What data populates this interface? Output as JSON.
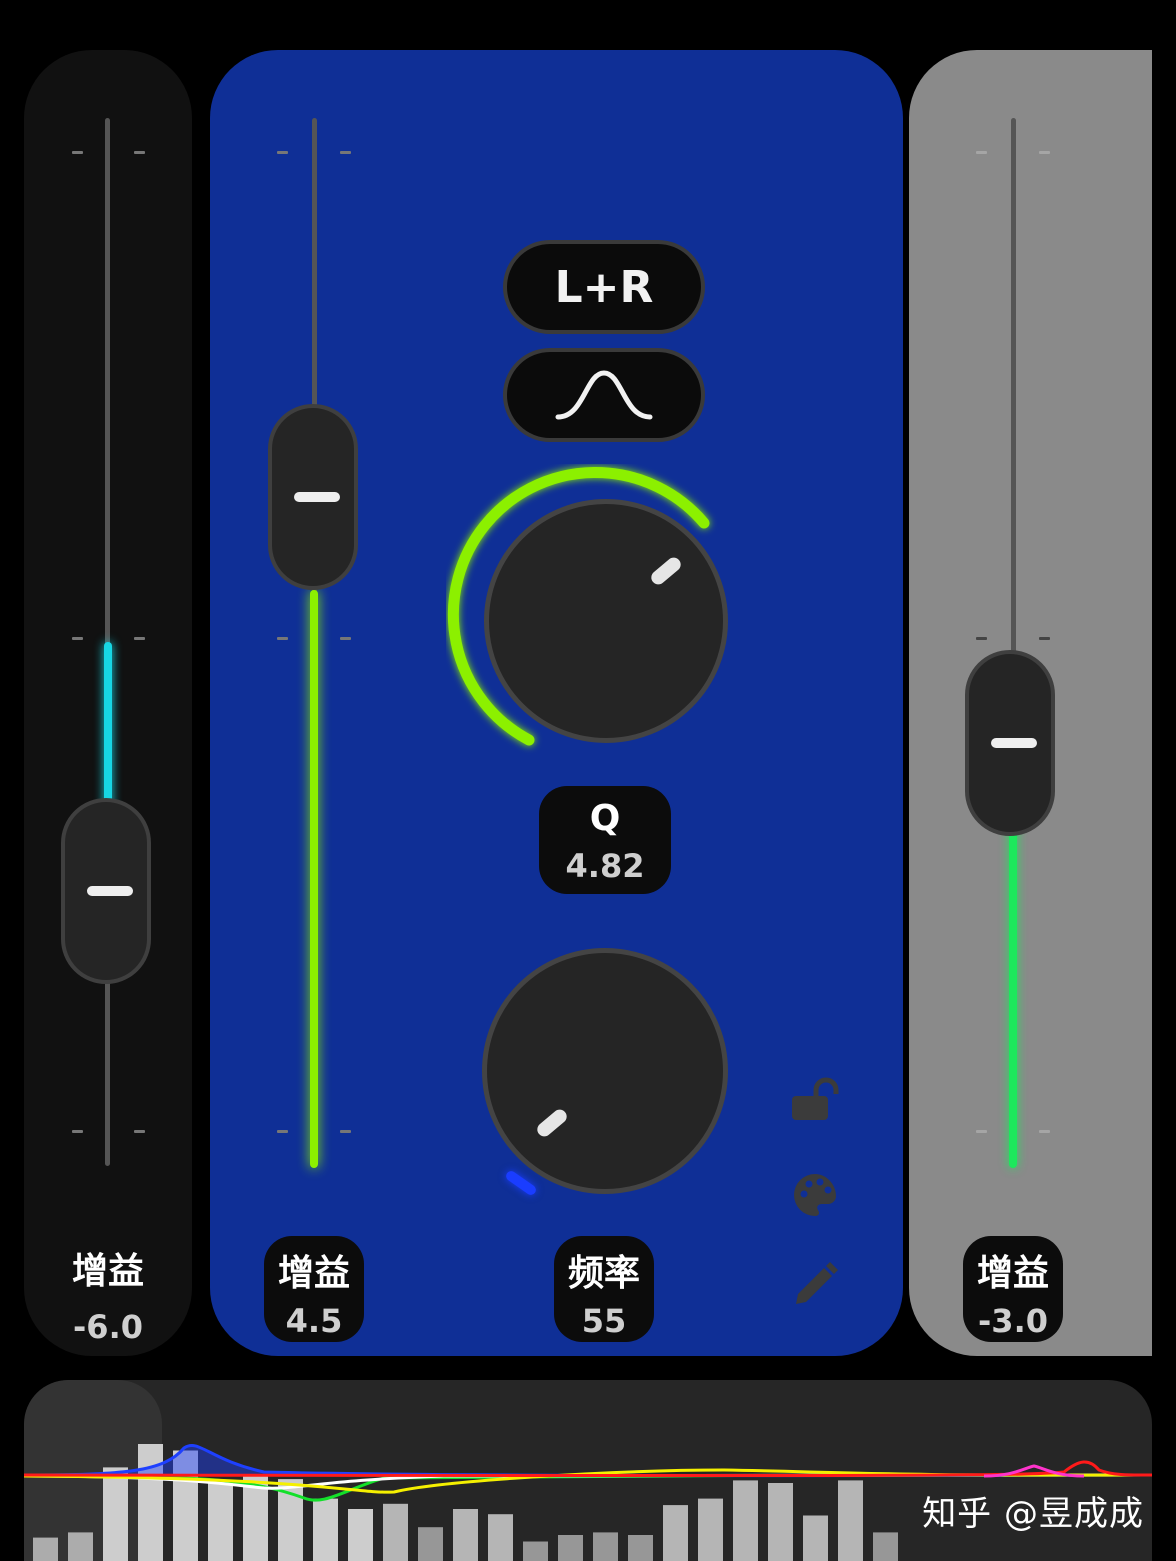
{
  "bands": {
    "left": {
      "title": "增益",
      "value": "-6.0",
      "gain": -6.0,
      "fill_color": "#17d6e4"
    },
    "center": {
      "gain_title": "增益",
      "gain_value": "4.5",
      "gain": 4.5,
      "fill_color": "#8cf000",
      "channel_label": "L+R",
      "filter_shape_icon": "bell-curve-icon",
      "q_label": "Q",
      "q_value": "4.82",
      "freq_title": "频率",
      "freq_value": "55",
      "side_icons": [
        "unlock-icon",
        "palette-icon",
        "pencil-icon"
      ]
    },
    "right": {
      "title": "增益",
      "value": "-3.0",
      "gain": -3.0,
      "fill_color": "#1de85c"
    }
  },
  "analyzer": {
    "bars": [
      0.18,
      0.22,
      0.72,
      0.9,
      0.85,
      0.62,
      0.66,
      0.63,
      0.48,
      0.4,
      0.44,
      0.26,
      0.4,
      0.36,
      0.15,
      0.2,
      0.22,
      0.2,
      0.43,
      0.48,
      0.62,
      0.6,
      0.35,
      0.62,
      0.22
    ],
    "curve_colors": [
      "#1e40ff",
      "#13e02a",
      "#ffffff",
      "#f5f000",
      "#ff1a1a",
      "#ff33cc"
    ]
  },
  "watermark": "知乎 @昱成成"
}
